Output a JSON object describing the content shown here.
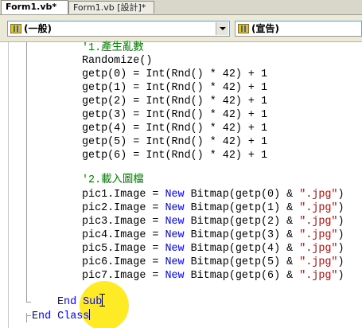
{
  "tabs": [
    {
      "label": "Form1.vb*",
      "active": true
    },
    {
      "label": "Form1.vb [設計]*",
      "active": false
    }
  ],
  "dropdowns": {
    "object_label": "(一般)",
    "procedure_label": "(宣告)"
  },
  "code": {
    "comment1": "'1.產生亂數",
    "randomize": "Randomize()",
    "getp_lines": [
      "getp(0) = Int(Rnd() * 42) + 1",
      "getp(1) = Int(Rnd() * 42) + 1",
      "getp(2) = Int(Rnd() * 42) + 1",
      "getp(3) = Int(Rnd() * 42) + 1",
      "getp(4) = Int(Rnd() * 42) + 1",
      "getp(5) = Int(Rnd() * 42) + 1",
      "getp(6) = Int(Rnd() * 42) + 1"
    ],
    "comment2": "'2.載入圖檔",
    "pic_lines": [
      {
        "left": "pic1.Image = ",
        "kw": "New",
        "mid": " Bitmap(getp(0) & ",
        "str": "\".jpg\"",
        "end": ")"
      },
      {
        "left": "pic2.Image = ",
        "kw": "New",
        "mid": " Bitmap(getp(1) & ",
        "str": "\".jpg\"",
        "end": ")"
      },
      {
        "left": "pic3.Image = ",
        "kw": "New",
        "mid": " Bitmap(getp(2) & ",
        "str": "\".jpg\"",
        "end": ")"
      },
      {
        "left": "pic4.Image = ",
        "kw": "New",
        "mid": " Bitmap(getp(3) & ",
        "str": "\".jpg\"",
        "end": ")"
      },
      {
        "left": "pic5.Image = ",
        "kw": "New",
        "mid": " Bitmap(getp(4) & ",
        "str": "\".jpg\"",
        "end": ")"
      },
      {
        "left": "pic6.Image = ",
        "kw": "New",
        "mid": " Bitmap(getp(5) & ",
        "str": "\".jpg\"",
        "end": ")"
      },
      {
        "left": "pic7.Image = ",
        "kw": "New",
        "mid": " Bitmap(getp(6) & ",
        "str": "\".jpg\"",
        "end": ")"
      }
    ],
    "end_sub": "End Sub",
    "end_class": "End Class"
  },
  "colors": {
    "keyword": "#0000ff",
    "comment": "#008000",
    "string": "#a31515",
    "cursor_highlight": "#ffe600"
  },
  "icons": [
    "class-icon",
    "method-icon",
    "chevron-down-icon"
  ]
}
